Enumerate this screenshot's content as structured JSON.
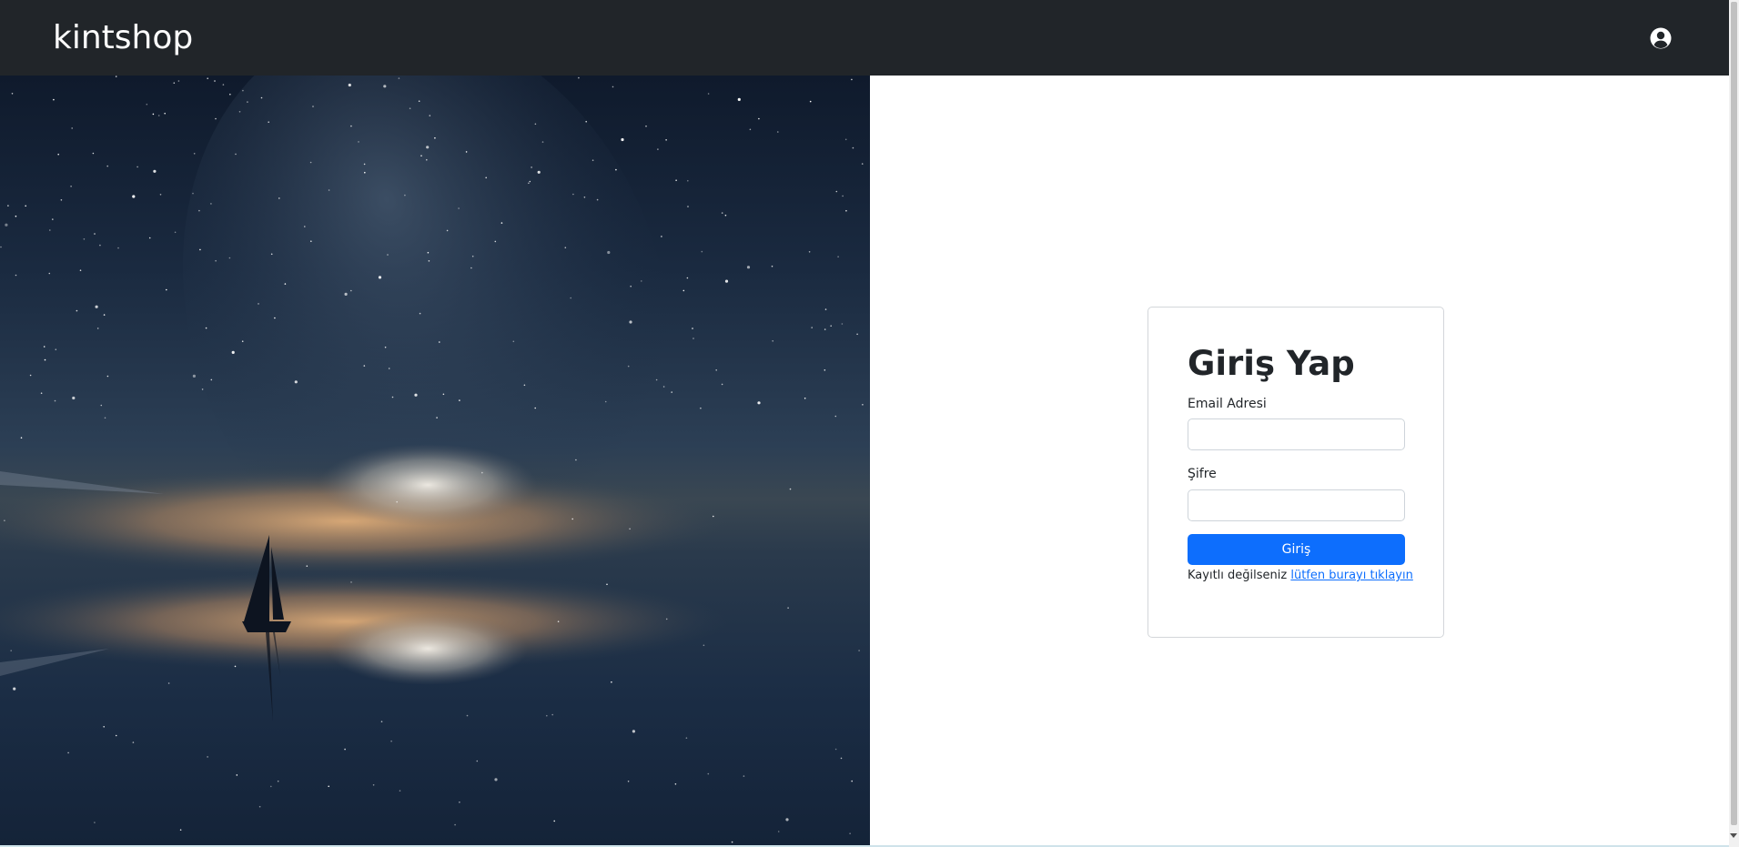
{
  "navbar": {
    "brand": "kintshop",
    "user_icon": "user-circle-icon"
  },
  "hero": {
    "image": "night-sky-sailboat-reflection"
  },
  "login": {
    "title": "Giriş Yap",
    "email_label": "Email Adresi",
    "email_value": "",
    "password_label": "Şifre",
    "password_value": "",
    "submit_label": "Giriş",
    "register_prompt": "Kayıtlı değilseniz",
    "register_link": "lütfen burayı tıklayın"
  },
  "colors": {
    "navbar_bg": "#212529",
    "primary": "#0d6efd",
    "text": "#212529"
  }
}
